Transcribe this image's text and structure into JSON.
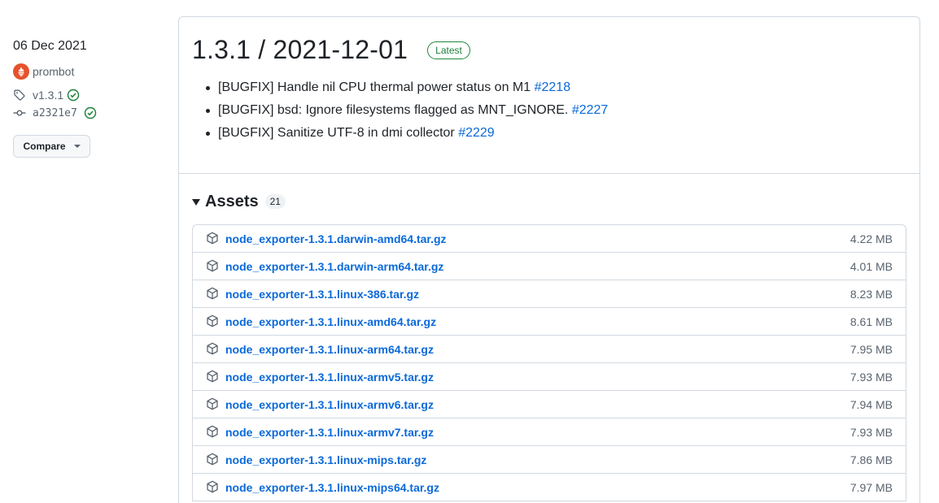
{
  "sidebar": {
    "date": "06 Dec 2021",
    "author": "prombot",
    "tag": "v1.3.1",
    "commit": "a2321e7",
    "compare_label": "Compare"
  },
  "release": {
    "title": "1.3.1 / 2021-12-01",
    "badge": "Latest",
    "notes": [
      {
        "text": "[BUGFIX] Handle nil CPU thermal power status on M1 ",
        "link": "#2218"
      },
      {
        "text": "[BUGFIX] bsd: Ignore filesystems flagged as MNT_IGNORE. ",
        "link": "#2227"
      },
      {
        "text": "[BUGFIX] Sanitize UTF-8 in dmi collector ",
        "link": "#2229"
      }
    ]
  },
  "assets": {
    "title": "Assets",
    "count": "21",
    "items": [
      {
        "name": "node_exporter-1.3.1.darwin-amd64.tar.gz",
        "size": "4.22 MB"
      },
      {
        "name": "node_exporter-1.3.1.darwin-arm64.tar.gz",
        "size": "4.01 MB"
      },
      {
        "name": "node_exporter-1.3.1.linux-386.tar.gz",
        "size": "8.23 MB"
      },
      {
        "name": "node_exporter-1.3.1.linux-amd64.tar.gz",
        "size": "8.61 MB"
      },
      {
        "name": "node_exporter-1.3.1.linux-arm64.tar.gz",
        "size": "7.95 MB"
      },
      {
        "name": "node_exporter-1.3.1.linux-armv5.tar.gz",
        "size": "7.93 MB"
      },
      {
        "name": "node_exporter-1.3.1.linux-armv6.tar.gz",
        "size": "7.94 MB"
      },
      {
        "name": "node_exporter-1.3.1.linux-armv7.tar.gz",
        "size": "7.93 MB"
      },
      {
        "name": "node_exporter-1.3.1.linux-mips.tar.gz",
        "size": "7.86 MB"
      },
      {
        "name": "node_exporter-1.3.1.linux-mips64.tar.gz",
        "size": "7.97 MB"
      }
    ]
  },
  "colors": {
    "link": "#0969da",
    "success": "#1a7f37",
    "border": "#d1d9e0",
    "avatar": "#e6522c"
  },
  "icons": {
    "tag": "tag-icon",
    "commit": "git-commit-icon",
    "verified": "check-circle-icon",
    "asset": "package-icon",
    "collapse": "triangle-down-icon"
  }
}
